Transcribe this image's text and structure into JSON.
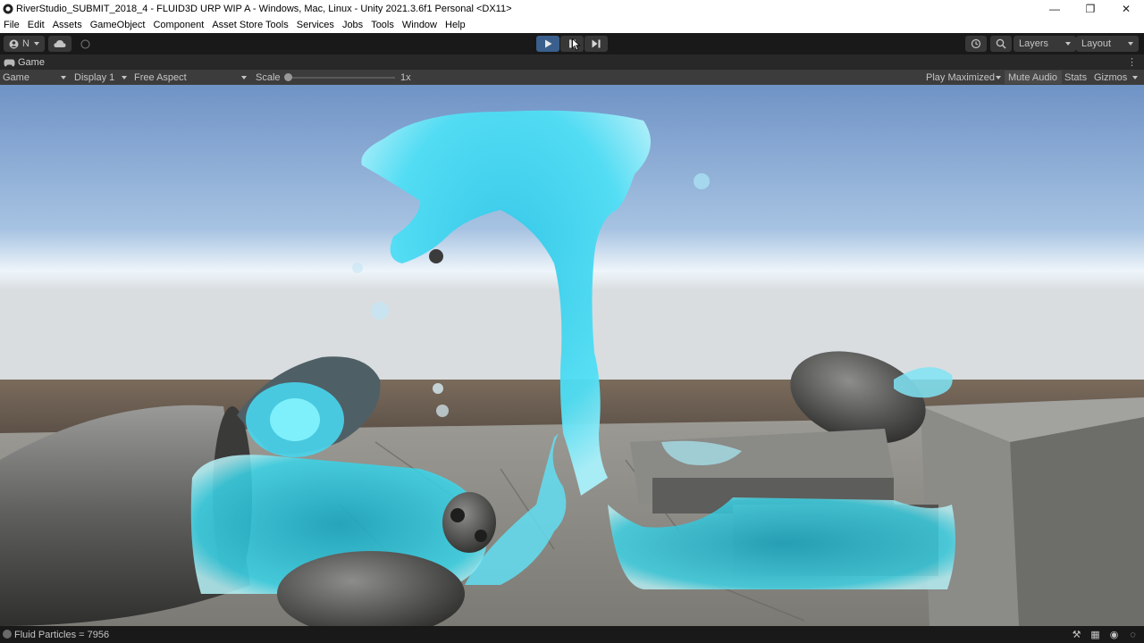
{
  "window": {
    "title": "RiverStudio_SUBMIT_2018_4 - FLUID3D URP WIP A - Windows, Mac, Linux - Unity 2021.3.6f1 Personal <DX11>",
    "minimize_glyph": "—",
    "maximize_glyph": "❐",
    "close_glyph": "✕"
  },
  "menu": {
    "items": [
      {
        "label": "File"
      },
      {
        "label": "Edit"
      },
      {
        "label": "Assets"
      },
      {
        "label": "GameObject"
      },
      {
        "label": "Component"
      },
      {
        "label": "Asset Store Tools"
      },
      {
        "label": "Services"
      },
      {
        "label": "Jobs"
      },
      {
        "label": "Tools"
      },
      {
        "label": "Window"
      },
      {
        "label": "Help"
      }
    ]
  },
  "toolbar": {
    "account_label": "N",
    "layers_label": "Layers",
    "layout_label": "Layout",
    "play_state": "playing",
    "accent_color": "#3a5f8c"
  },
  "game_tab": {
    "label": "Game"
  },
  "game_controls": {
    "view_mode": "Game",
    "display": "Display 1",
    "aspect": "Free Aspect",
    "scale_label": "Scale",
    "scale_value": "1x",
    "play_maximized": "Play Maximized",
    "mute_audio": "Mute Audio",
    "stats": "Stats",
    "gizmos": "Gizmos"
  },
  "status": {
    "message": "Fluid Particles = 7956"
  },
  "scene": {
    "water_color": "#3fd8ef",
    "sky_top": "#6f93c6",
    "sky_horizon": "#eef5fa",
    "stone_color": "#8a8a86"
  }
}
